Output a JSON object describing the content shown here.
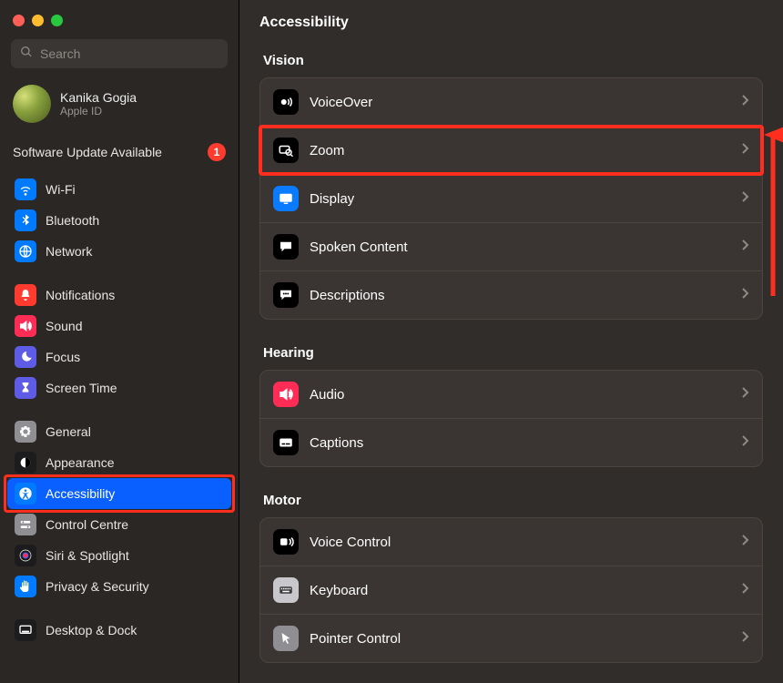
{
  "header": {
    "title": "Accessibility"
  },
  "search": {
    "placeholder": "Search"
  },
  "account": {
    "name": "Kanika Gogia",
    "sub": "Apple ID"
  },
  "update": {
    "label": "Software Update Available",
    "count": "1"
  },
  "sidebar": {
    "groups": [
      {
        "items": [
          {
            "label": "Wi-Fi",
            "bg": "bg-blue",
            "icon": "wifi"
          },
          {
            "label": "Bluetooth",
            "bg": "bg-blue",
            "icon": "bluetooth"
          },
          {
            "label": "Network",
            "bg": "bg-blue",
            "icon": "globe"
          }
        ]
      },
      {
        "items": [
          {
            "label": "Notifications",
            "bg": "bg-red",
            "icon": "bell"
          },
          {
            "label": "Sound",
            "bg": "bg-pink",
            "icon": "speaker"
          },
          {
            "label": "Focus",
            "bg": "bg-indigo",
            "icon": "moon"
          },
          {
            "label": "Screen Time",
            "bg": "bg-indigo",
            "icon": "hourglass"
          }
        ]
      },
      {
        "items": [
          {
            "label": "General",
            "bg": "bg-gray",
            "icon": "gear"
          },
          {
            "label": "Appearance",
            "bg": "bg-dark",
            "icon": "appearance"
          },
          {
            "label": "Accessibility",
            "bg": "bg-blue",
            "icon": "accessibility",
            "selected": true,
            "highlight": true
          },
          {
            "label": "Control Centre",
            "bg": "bg-gray",
            "icon": "switches"
          },
          {
            "label": "Siri & Spotlight",
            "bg": "bg-dark",
            "icon": "siri"
          },
          {
            "label": "Privacy & Security",
            "bg": "bg-blue",
            "icon": "hand"
          }
        ]
      },
      {
        "items": [
          {
            "label": "Desktop & Dock",
            "bg": "bg-dark",
            "icon": "dock"
          }
        ]
      }
    ]
  },
  "sections": [
    {
      "title": "Vision",
      "rows": [
        {
          "label": "VoiceOver",
          "bg": "bg-black",
          "icon": "voiceover"
        },
        {
          "label": "Zoom",
          "bg": "bg-black",
          "icon": "zoom",
          "highlight": true
        },
        {
          "label": "Display",
          "bg": "bg-blue2",
          "icon": "display"
        },
        {
          "label": "Spoken Content",
          "bg": "bg-black",
          "icon": "bubble"
        },
        {
          "label": "Descriptions",
          "bg": "bg-black",
          "icon": "bubble-dots"
        }
      ]
    },
    {
      "title": "Hearing",
      "rows": [
        {
          "label": "Audio",
          "bg": "bg-pink",
          "icon": "speaker"
        },
        {
          "label": "Captions",
          "bg": "bg-black",
          "icon": "captions"
        }
      ]
    },
    {
      "title": "Motor",
      "rows": [
        {
          "label": "Voice Control",
          "bg": "bg-black",
          "icon": "voicecontrol"
        },
        {
          "label": "Keyboard",
          "bg": "bg-ltgray",
          "icon": "keyboard"
        },
        {
          "label": "Pointer Control",
          "bg": "bg-gray",
          "icon": "pointer"
        }
      ]
    }
  ]
}
